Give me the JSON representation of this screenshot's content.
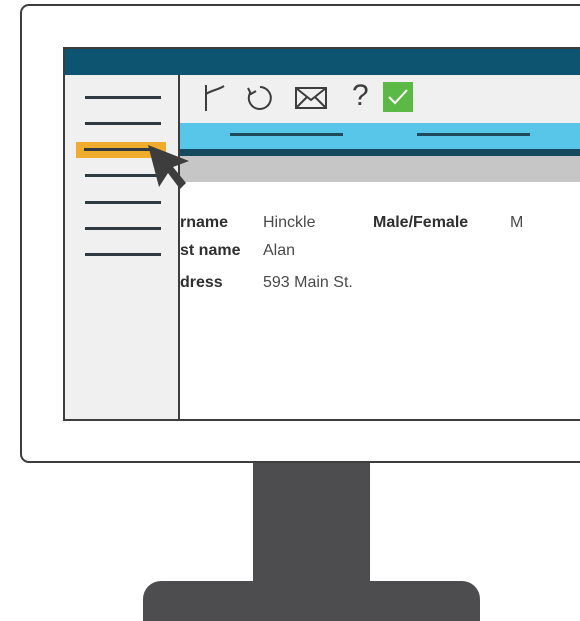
{
  "form": {
    "surname_label": "rname",
    "surname_value": "Hinckle",
    "gender_label": "Male/Female",
    "gender_value": "M",
    "firstname_label": "st name",
    "firstname_value": "Alan",
    "address_label": "dress",
    "address_value": "593 Main St."
  },
  "toolbar": {
    "help_label": "?",
    "icons": [
      "flag-icon",
      "refresh-icon",
      "mail-icon",
      "help-icon",
      "check-icon"
    ]
  },
  "sidebar": {
    "item_count": 7,
    "selected_index": 1
  },
  "colors": {
    "title_bar": "#0d5470",
    "tab_strip": "#58c6e8",
    "selected_item": "#f0ac2c",
    "check_button": "#5cb946",
    "stand": "#4d4d4f"
  }
}
